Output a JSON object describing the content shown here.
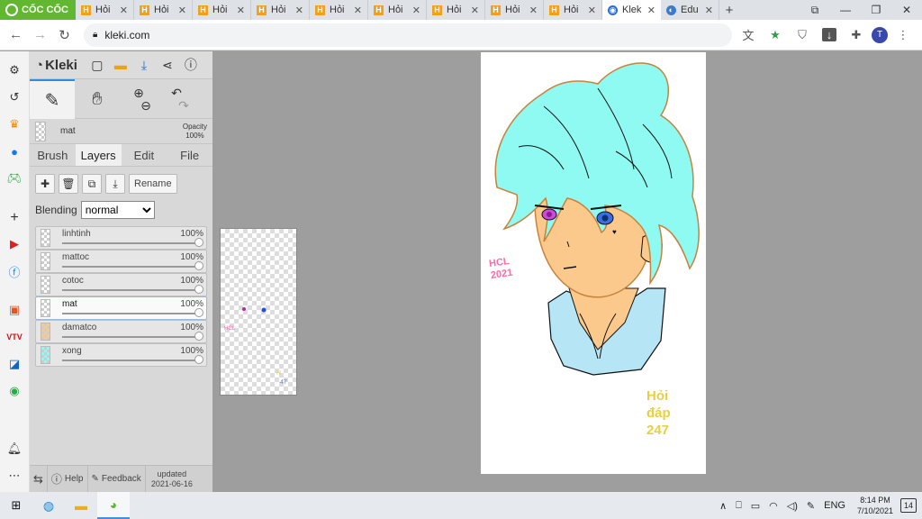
{
  "browser": {
    "brand": "CỐC CỐC",
    "tabs": [
      {
        "title": "Hỏi"
      },
      {
        "title": "Hỏi"
      },
      {
        "title": "Hỏi"
      },
      {
        "title": "Hỏi"
      },
      {
        "title": "Hỏi"
      },
      {
        "title": "Hỏi"
      },
      {
        "title": "Hỏi"
      },
      {
        "title": "Hỏi"
      },
      {
        "title": "Hỏi"
      },
      {
        "title": "Klek"
      },
      {
        "title": "Edu"
      }
    ],
    "tab_favicon": "H",
    "url": "kleki.com",
    "profile_initial": "T"
  },
  "kleki": {
    "app_name": "Kleki",
    "current_layer": "mat",
    "opacity_label": "Opacity",
    "opacity_value": "100%",
    "tabs": [
      "Brush",
      "Layers",
      "Edit",
      "File"
    ],
    "rename_label": "Rename",
    "blending_label": "Blending",
    "blending_value": "normal",
    "layers": [
      {
        "name": "linhtinh",
        "opacity": "100%"
      },
      {
        "name": "mattoc",
        "opacity": "100%"
      },
      {
        "name": "cotoc",
        "opacity": "100%"
      },
      {
        "name": "mat",
        "opacity": "100%",
        "selected": true
      },
      {
        "name": "damatco",
        "opacity": "100%"
      },
      {
        "name": "xong",
        "opacity": "100%"
      }
    ],
    "footer": {
      "help": "Help",
      "feedback": "Feedback",
      "updated_label": "updated",
      "updated_date": "2021-06-16"
    }
  },
  "artwork": {
    "signature_left": "HCL 2021",
    "signature_right": "Hỏi đáp 247"
  },
  "taskbar": {
    "language": "ENG",
    "time": "8:14 PM",
    "date": "7/10/2021",
    "notifications": "14"
  },
  "colors": {
    "hair": "#8ffaf2",
    "skin": "#fcc98d",
    "shirt": "#b6e6f6",
    "accent": "#2e8ce0"
  }
}
